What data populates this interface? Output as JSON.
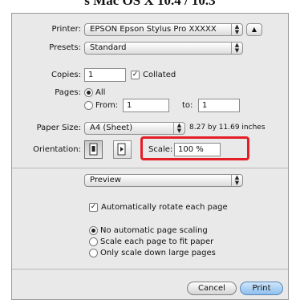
{
  "heading": "s Mac OS X 10.4 / 10.3",
  "printer": {
    "label": "Printer:",
    "value": "EPSON Epson Stylus Pro XXXXX"
  },
  "presets": {
    "label": "Presets:",
    "value": "Standard"
  },
  "copies": {
    "label": "Copies:",
    "value": "1",
    "collated_label": "Collated",
    "collated_checked": true
  },
  "pages": {
    "label": "Pages:",
    "all_label": "All",
    "from_label": "From:",
    "from_value": "1",
    "to_label": "to:",
    "to_value": "1",
    "selected": "All"
  },
  "paper_size": {
    "label": "Paper Size:",
    "value": "A4 (Sheet)",
    "dimensions": "8.27 by 11.69 inches"
  },
  "orientation": {
    "label": "Orientation:",
    "selected": "portrait"
  },
  "scale": {
    "label": "Scale:",
    "value": "100 %"
  },
  "panel": {
    "value": "Preview"
  },
  "auto_rotate": {
    "label": "Automatically rotate each page",
    "checked": true
  },
  "scaling_options": [
    {
      "label": "No automatic page scaling",
      "selected": true
    },
    {
      "label": "Scale each page to fit paper",
      "selected": false
    },
    {
      "label": "Only scale down large pages",
      "selected": false
    }
  ],
  "buttons": {
    "cancel": "Cancel",
    "print": "Print"
  },
  "colors": {
    "highlight": "#e41e26",
    "default_button": "#8ec0ee"
  }
}
